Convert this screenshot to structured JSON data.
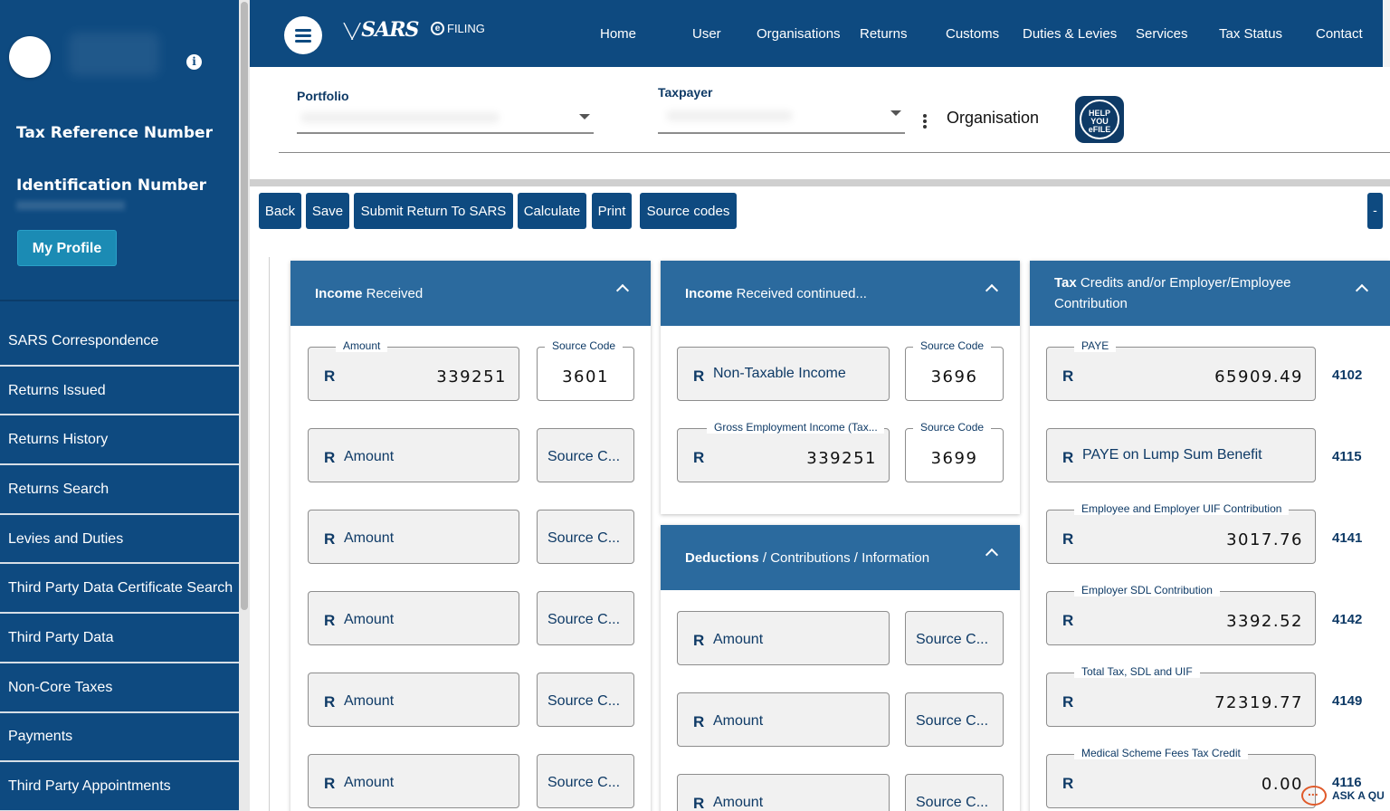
{
  "sidebar": {
    "tax_ref_label": "Tax Reference Number",
    "id_label": "Identification Number",
    "profile_button": "My Profile",
    "nav": [
      "SARS Correspondence",
      "Returns Issued",
      "Returns History",
      "Returns Search",
      "Levies and Duties",
      "Third Party Data Certificate Search",
      "Third Party Data",
      "Non-Core Taxes",
      "Payments",
      "Third Party Appointments"
    ]
  },
  "header": {
    "logo": "SARS",
    "logo_sub": "FILING",
    "nav": [
      "Home",
      "User",
      "Organisations",
      "Returns",
      "Customs",
      "Duties & Levies",
      "Services",
      "Tax Status",
      "Contact"
    ]
  },
  "portfolio": {
    "portfolio_label": "Portfolio",
    "taxpayer_label": "Taxpayer",
    "organisation_label": "Organisation",
    "help_badge": "HELP YOU eFILE"
  },
  "toolbar": {
    "buttons": [
      "Back",
      "Save",
      "Submit Return To SARS",
      "Calculate",
      "Print",
      "Source codes"
    ],
    "collapse": "-"
  },
  "panels": {
    "income": {
      "title_bold": "Income",
      "title_rest": " Received",
      "rows": [
        {
          "amount_legend": "Amount",
          "amount": "339251",
          "code_legend": "Source Code",
          "code": "3601"
        },
        {
          "amount_placeholder": "Amount",
          "code_placeholder": "Source C..."
        },
        {
          "amount_placeholder": "Amount",
          "code_placeholder": "Source C..."
        },
        {
          "amount_placeholder": "Amount",
          "code_placeholder": "Source C..."
        },
        {
          "amount_placeholder": "Amount",
          "code_placeholder": "Source C..."
        },
        {
          "amount_placeholder": "Amount",
          "code_placeholder": "Source C..."
        }
      ]
    },
    "income_cont": {
      "title_bold": "Income",
      "title_rest": " Received continued...",
      "rows": [
        {
          "text": "Non-Taxable Income",
          "code_legend": "Source Code",
          "code": "3696"
        },
        {
          "amount_legend": "Gross Employment Income (Tax...",
          "amount": "339251",
          "code_legend": "Source Code",
          "code": "3699"
        }
      ]
    },
    "deductions": {
      "title_bold": "Deductions",
      "title_rest": " / Contributions / Information",
      "rows": [
        {
          "amount_placeholder": "Amount",
          "code_placeholder": "Source C..."
        },
        {
          "amount_placeholder": "Amount",
          "code_placeholder": "Source C..."
        },
        {
          "amount_placeholder": "Amount",
          "code_placeholder": "Source C..."
        }
      ]
    },
    "tax_credits": {
      "title_bold": "Tax",
      "title_rest": " Credits and/or Employer/Employee Contribution",
      "rows": [
        {
          "legend": "PAYE",
          "value": "65909.49",
          "code": "4102"
        },
        {
          "text": "PAYE on Lump Sum Benefit",
          "code": "4115"
        },
        {
          "legend": "Employee and Employer UIF Contribution",
          "value": "3017.76",
          "code": "4141"
        },
        {
          "legend": "Employer SDL Contribution",
          "value": "3392.52",
          "code": "4142"
        },
        {
          "legend": "Total Tax, SDL and UIF",
          "value": "72319.77",
          "code": "4149"
        },
        {
          "legend": "Medical Scheme Fees Tax Credit",
          "value": "0.00",
          "code": "4116"
        }
      ]
    }
  },
  "currency": "R",
  "ask_button": "ASK A QU"
}
